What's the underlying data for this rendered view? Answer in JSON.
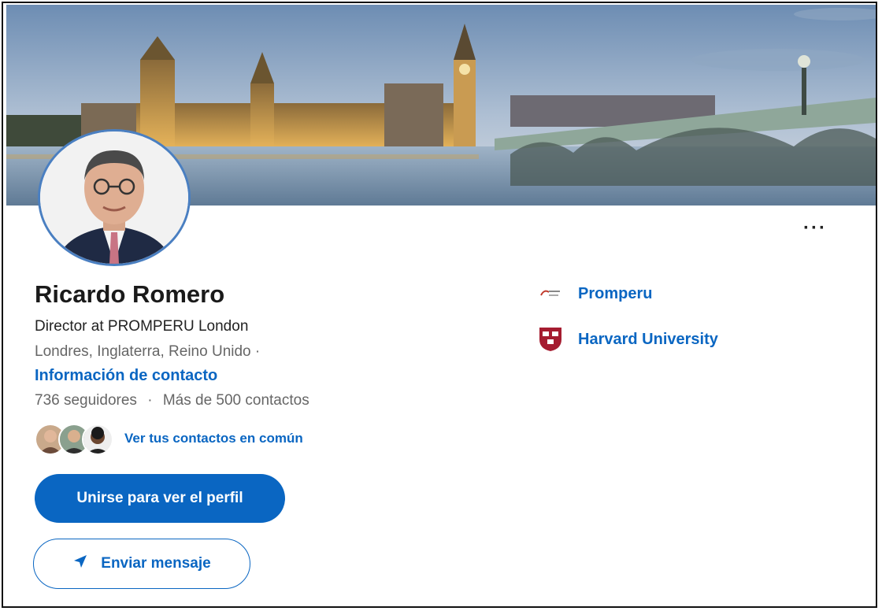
{
  "profile": {
    "name": "Ricardo Romero",
    "headline": "Director at PROMPERU London",
    "location": "Londres, Inglaterra, Reino Unido  ·",
    "contact_info_label": "Información de contacto",
    "followers": "736 seguidores",
    "separator": "·",
    "connections": "Más de 500 contactos",
    "mutual_label": "Ver tus contactos en común"
  },
  "actions": {
    "join_label": "Unirse para ver el perfil",
    "message_label": "Enviar mensaje",
    "more_label": "···"
  },
  "aside": {
    "items": [
      {
        "label": "Promperu",
        "icon": "promperu-logo"
      },
      {
        "label": "Harvard University",
        "icon": "harvard-logo"
      }
    ]
  },
  "colors": {
    "brand": "#0a66c2",
    "avatar_ring": "#4a7fc1"
  }
}
